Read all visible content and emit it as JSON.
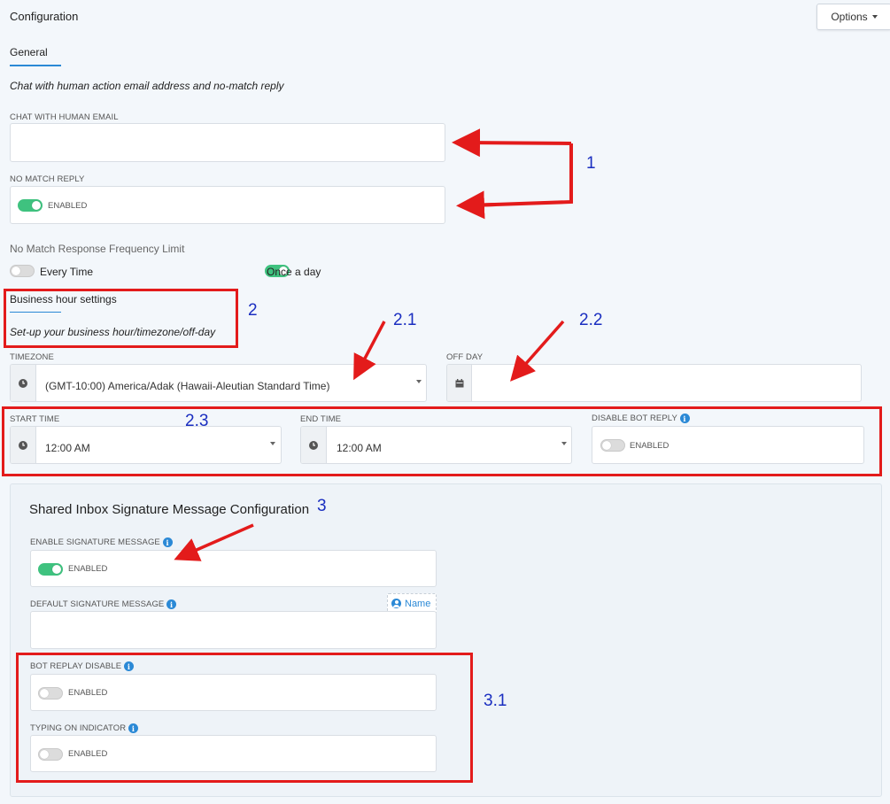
{
  "header": {
    "title": "Configuration",
    "options_label": "Options"
  },
  "tabs": [
    {
      "label": "General",
      "active": true
    }
  ],
  "general": {
    "subtitle": "Chat with human action email address and no-match reply",
    "chat_email_label": "CHAT WITH HUMAN EMAIL",
    "chat_email_value": "",
    "no_match_label": "NO MATCH REPLY",
    "no_match_toggle": {
      "on": true,
      "text": "ENABLED"
    },
    "freq_title": "No Match Response Frequency Limit",
    "freq_options": [
      {
        "label": "Every Time",
        "on": false
      },
      {
        "label": "Once a day",
        "on": true
      }
    ]
  },
  "business": {
    "title": "Business hour settings",
    "subtitle": "Set-up your business hour/timezone/off-day",
    "timezone_label": "TIMEZONE",
    "timezone_value": "(GMT-10:00) America/Adak (Hawaii-Aleutian Standard Time)",
    "offday_label": "OFF DAY",
    "offday_value": "",
    "start_label": "START TIME",
    "start_value": "12:00 AM",
    "end_label": "END TIME",
    "end_value": "12:00 AM",
    "disable_bot_label": "DISABLE BOT REPLY",
    "disable_bot_toggle": {
      "on": false,
      "text": "ENABLED"
    }
  },
  "signature": {
    "title": "Shared Inbox Signature Message Configuration",
    "enable_label": "ENABLE SIGNATURE MESSAGE",
    "enable_toggle": {
      "on": true,
      "text": "ENABLED"
    },
    "default_label": "DEFAULT SIGNATURE MESSAGE",
    "name_chip": "Name",
    "bot_replay_label": "BOT REPLAY DISABLE",
    "bot_replay_toggle": {
      "on": false,
      "text": "ENABLED"
    },
    "typing_label": "TYPING ON INDICATOR",
    "typing_toggle": {
      "on": false,
      "text": "ENABLED"
    }
  },
  "annotations": [
    "1",
    "2",
    "2.1",
    "2.2",
    "2.3",
    "3",
    "3.1"
  ],
  "colors": {
    "accent": "#2b89d6",
    "toggle_on": "#3fc27f",
    "annotation_red": "#e31b1b",
    "annotation_blue": "#1a2ec0"
  }
}
